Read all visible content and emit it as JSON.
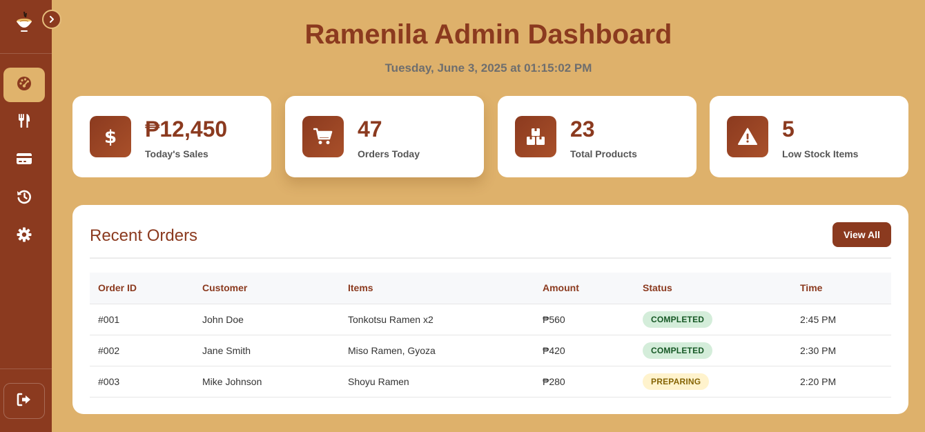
{
  "app": {
    "title": "Ramenila Admin Dashboard",
    "datetime": "Tuesday, June 3, 2025 at 01:15:02 PM"
  },
  "sidebar": {
    "logo_icon": "ramen-bowl-icon",
    "toggle_icon": "chevron-right-icon",
    "items": [
      {
        "icon": "dashboard-gauge-icon",
        "active": true
      },
      {
        "icon": "utensils-icon",
        "active": false
      },
      {
        "icon": "credit-card-icon",
        "active": false
      },
      {
        "icon": "history-icon",
        "active": false
      },
      {
        "icon": "gear-icon",
        "active": false
      }
    ],
    "logout_icon": "sign-out-icon"
  },
  "stats": [
    {
      "icon": "dollar-icon",
      "value": "₱12,450",
      "label": "Today's Sales"
    },
    {
      "icon": "cart-icon",
      "value": "47",
      "label": "Orders Today"
    },
    {
      "icon": "boxes-icon",
      "value": "23",
      "label": "Total Products"
    },
    {
      "icon": "warning-icon",
      "value": "5",
      "label": "Low Stock Items"
    }
  ],
  "recent_orders": {
    "title": "Recent Orders",
    "view_all_label": "View All",
    "columns": [
      "Order ID",
      "Customer",
      "Items",
      "Amount",
      "Status",
      "Time"
    ],
    "rows": [
      {
        "id": "#001",
        "customer": "John Doe",
        "items": "Tonkotsu Ramen x2",
        "amount": "₱560",
        "status": "COMPLETED",
        "time": "2:45 PM"
      },
      {
        "id": "#002",
        "customer": "Jane Smith",
        "items": "Miso Ramen, Gyoza",
        "amount": "₱420",
        "status": "COMPLETED",
        "time": "2:30 PM"
      },
      {
        "id": "#003",
        "customer": "Mike Johnson",
        "items": "Shoyu Ramen",
        "amount": "₱280",
        "status": "PREPARING",
        "time": "2:20 PM"
      }
    ]
  },
  "colors": {
    "primary": "#8B3A1F",
    "background": "#DEB16B",
    "completed_bg": "#D4EDDA",
    "preparing_bg": "#FFF3CD"
  }
}
